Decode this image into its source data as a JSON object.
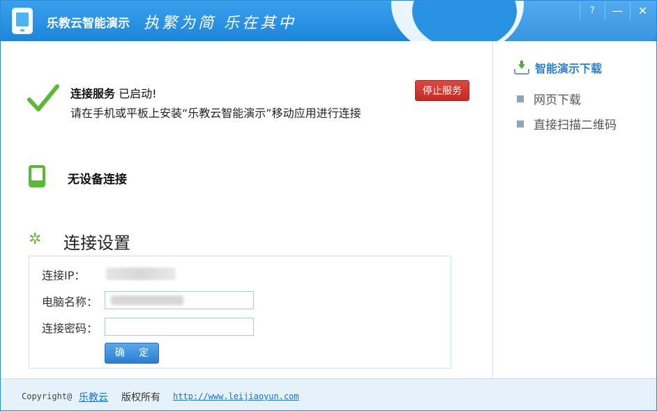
{
  "window": {
    "title": "乐教云智能演示",
    "slogan": "执繁为简 乐在其中",
    "controls": {
      "help": "?",
      "minimize": "—",
      "close": "✕"
    }
  },
  "status": {
    "title_strong": "连接服务",
    "title_rest": "已启动!",
    "subtitle": "请在手机或平板上安装“乐教云智能演示”移动应用进行连接",
    "stop_button": "停止服务"
  },
  "device": {
    "label": "无设备连接"
  },
  "settings": {
    "title": "连接设置",
    "ip_label": "连接IP：",
    "name_label": "电脑名称：",
    "password_label": "连接密码：",
    "password_value": "",
    "ok_button": "确 定"
  },
  "sidebar": {
    "download_label": "智能演示下载",
    "items": [
      {
        "label": "网页下载"
      },
      {
        "label": "直接扫描二维码"
      }
    ]
  },
  "footer": {
    "copyright": "Copyright@",
    "brand": "乐教云",
    "rights": "版权所有",
    "url": "http://www.leijiaoyun.com"
  },
  "colors": {
    "titlebar": "#1d86da",
    "check_green": "#5cb936",
    "stop_red": "#c22a23",
    "ok_blue": "#2b7fd1",
    "link_blue": "#1b6fc6"
  }
}
